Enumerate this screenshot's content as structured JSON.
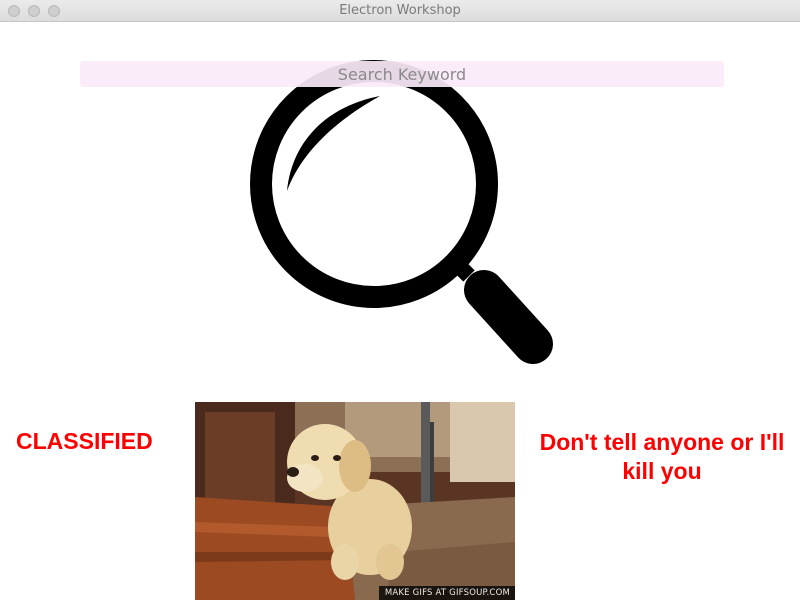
{
  "window": {
    "title": "Electron Workshop"
  },
  "search": {
    "placeholder": "Search Keyword",
    "value": ""
  },
  "left_text": "CLASSIFIED",
  "right_text": "Don't tell anyone or I'll kill you",
  "gif": {
    "watermark": "MAKE GIFS AT GIFSOUP.COM"
  },
  "icons": {
    "main": "magnifying-glass-icon"
  },
  "colors": {
    "search_bg": "#fbeaf8",
    "alert_text": "#ff0000",
    "icon": "#000000"
  }
}
